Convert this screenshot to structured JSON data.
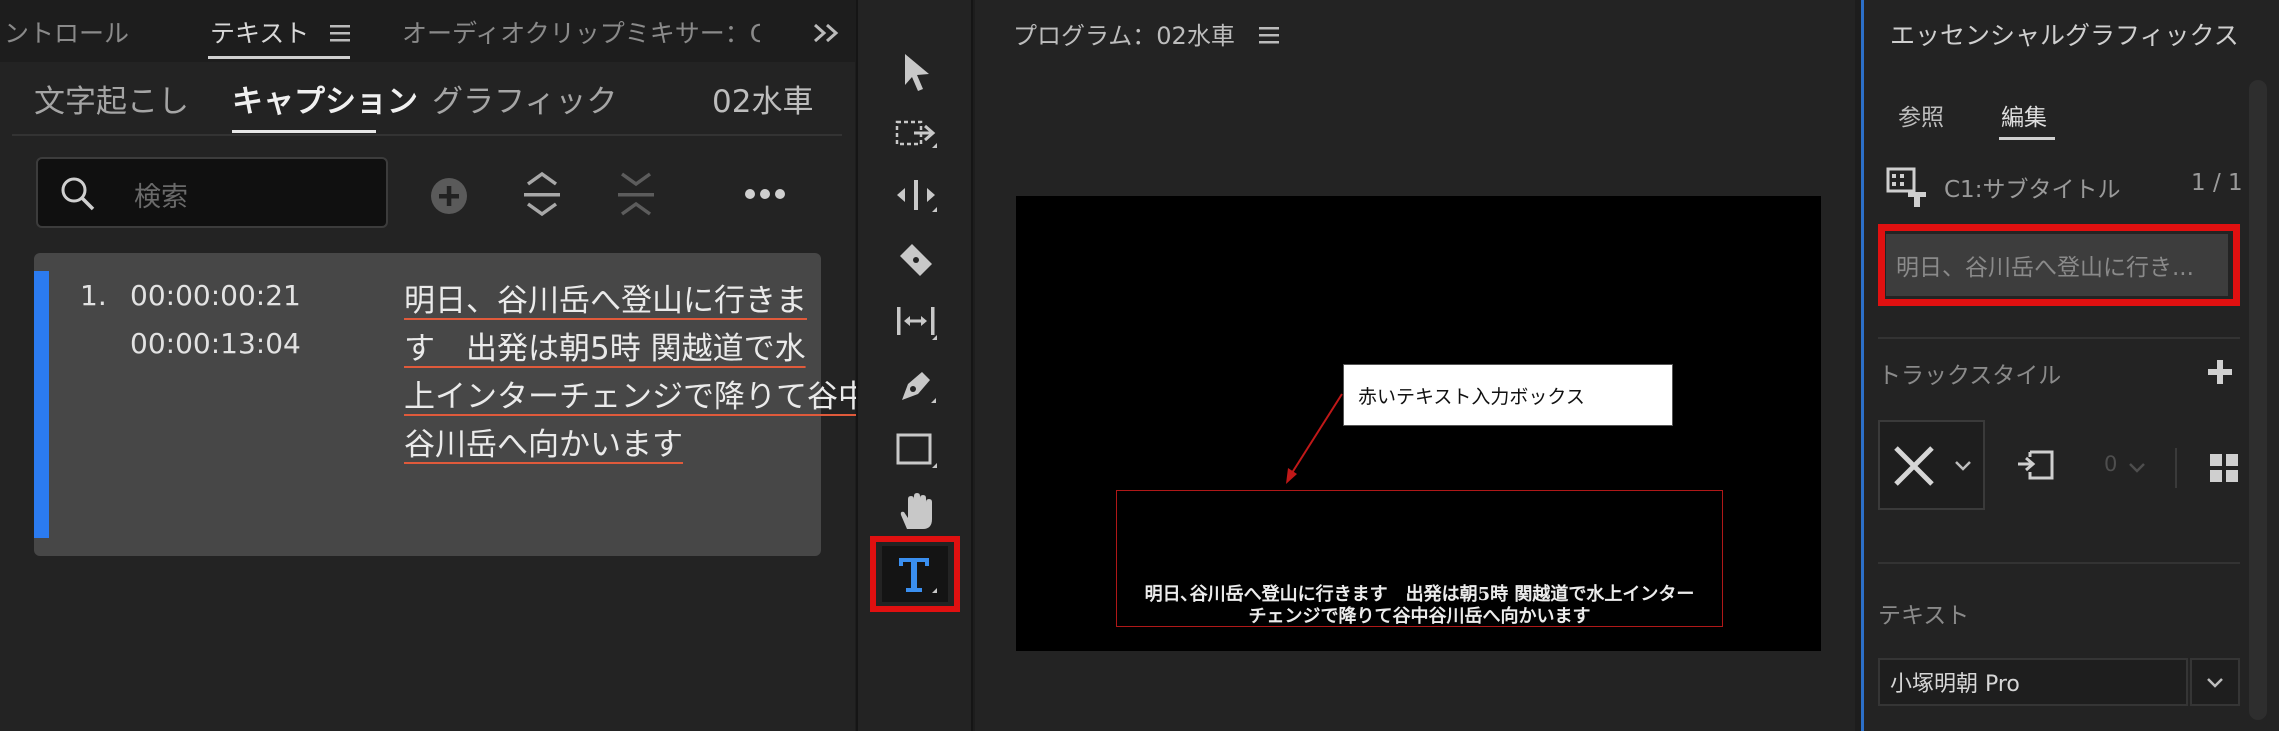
{
  "left_panel": {
    "tabs": [
      {
        "label": "ントロール"
      },
      {
        "label": "テキスト"
      },
      {
        "label": "オーディオクリップミキサー：C"
      }
    ],
    "subtabs": [
      {
        "label": "文字起こし"
      },
      {
        "label": "キャプション"
      },
      {
        "label": "グラフィック"
      }
    ],
    "sequence_name": "02水車",
    "search": {
      "placeholder": "検索"
    },
    "caption": {
      "index": "1.",
      "in_time": "00:00:00:21",
      "out_time": "00:00:13:04",
      "lines": [
        "明日、谷川岳へ登山に行きま",
        "す　出発は朝5時 関越道で水",
        "上インターチェンジで降りて谷中",
        "谷川岳へ向かいます"
      ]
    }
  },
  "program_panel": {
    "title": "プログラム：02水車",
    "callout_label": "赤いテキスト入力ボックス",
    "subtitle_lines": [
      "明日､谷川岳へ登山に行きます　出発は朝5時 関越道で水上インター",
      "チェンジで降りて谷中谷川岳へ向かいます"
    ]
  },
  "essential_graphics": {
    "title": "エッセンシャルグラフィックス",
    "tabs": [
      {
        "label": "参照"
      },
      {
        "label": "編集"
      }
    ],
    "track_name": "C1:サブタイトル",
    "track_count": "1 / 1",
    "text_field_value": "明日、谷川岳へ登山に行き...",
    "track_style_label": "トラックスタイル",
    "style_value": "0",
    "text_section_label": "テキスト",
    "font_value": "小塚明朝 Pro"
  },
  "colors": {
    "accent_blue": "#2b7bf0",
    "highlight_red": "#e01010",
    "underline_red": "#e05a3b",
    "tool_blue": "#3a8ff0"
  }
}
